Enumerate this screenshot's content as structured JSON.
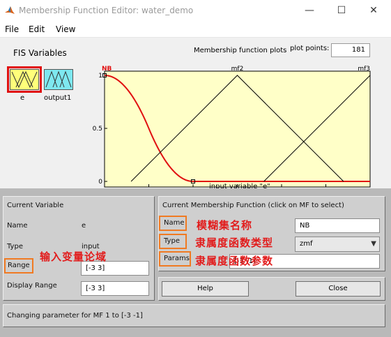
{
  "window": {
    "title": "Membership Function Editor: water_demo",
    "minimize_glyph": "—",
    "maximize_glyph": "☐",
    "close_glyph": "✕"
  },
  "menu": [
    "File",
    "Edit",
    "View"
  ],
  "fis_panel": {
    "label": "FIS Variables",
    "variables": [
      {
        "name": "e",
        "kind": "input",
        "selected": true
      },
      {
        "name": "output1",
        "kind": "output",
        "selected": false
      }
    ]
  },
  "plot": {
    "title": "Membership function plots",
    "plot_points_label": "plot points:",
    "plot_points_value": "181",
    "xlabel": "input variable \"e\"",
    "x_ticks": [
      "-3",
      "-2",
      "-1",
      "0",
      "1",
      "2",
      "3"
    ],
    "y_ticks": [
      "0",
      "0.5",
      "1"
    ],
    "mf_labels": [
      "NB",
      "mf2",
      "mf3"
    ],
    "colors": {
      "background": "#ffffc8",
      "selected_mf": "#e01010",
      "mf": "#000000"
    }
  },
  "chart_data": {
    "type": "line",
    "xlabel": "input variable \"e\"",
    "xlim": [
      -3,
      3
    ],
    "ylim": [
      0,
      1
    ],
    "series": [
      {
        "name": "NB",
        "mf_type": "zmf",
        "params": [
          -3,
          -1
        ],
        "x": [
          -3,
          -2.5,
          -2,
          -1.5,
          -1,
          3
        ],
        "y": [
          1,
          0.875,
          0.5,
          0.125,
          0,
          0
        ]
      },
      {
        "name": "mf2",
        "mf_type": "trimf",
        "x": [
          -2.4,
          0,
          2.4
        ],
        "y": [
          0,
          1,
          0
        ]
      },
      {
        "name": "mf3",
        "mf_type": "trimf",
        "x": [
          0.6,
          3
        ],
        "y": [
          0,
          1
        ]
      }
    ]
  },
  "current_variable": {
    "header": "Current Variable",
    "name_label": "Name",
    "name_value": "e",
    "type_label": "Type",
    "type_value": "input",
    "range_label": "Range",
    "range_value": "[-3 3]",
    "display_range_label": "Display Range",
    "display_range_value": "[-3 3]"
  },
  "current_mf": {
    "header": "Current Membership Function (click on MF to select)",
    "name_label": "Name",
    "name_value": "NB",
    "type_label": "Type",
    "type_value": "zmf",
    "params_label": "Params",
    "params_value": "[-3 -1]"
  },
  "buttons": {
    "help": "Help",
    "close": "Close"
  },
  "status": "Changing parameter for MF 1 to  [-3 -1]",
  "annotations": {
    "range_note": "输入变量论域",
    "name_note": "模糊集名称",
    "type_note": "隶属度函数类型",
    "params_note": "隶属度函数参数"
  }
}
